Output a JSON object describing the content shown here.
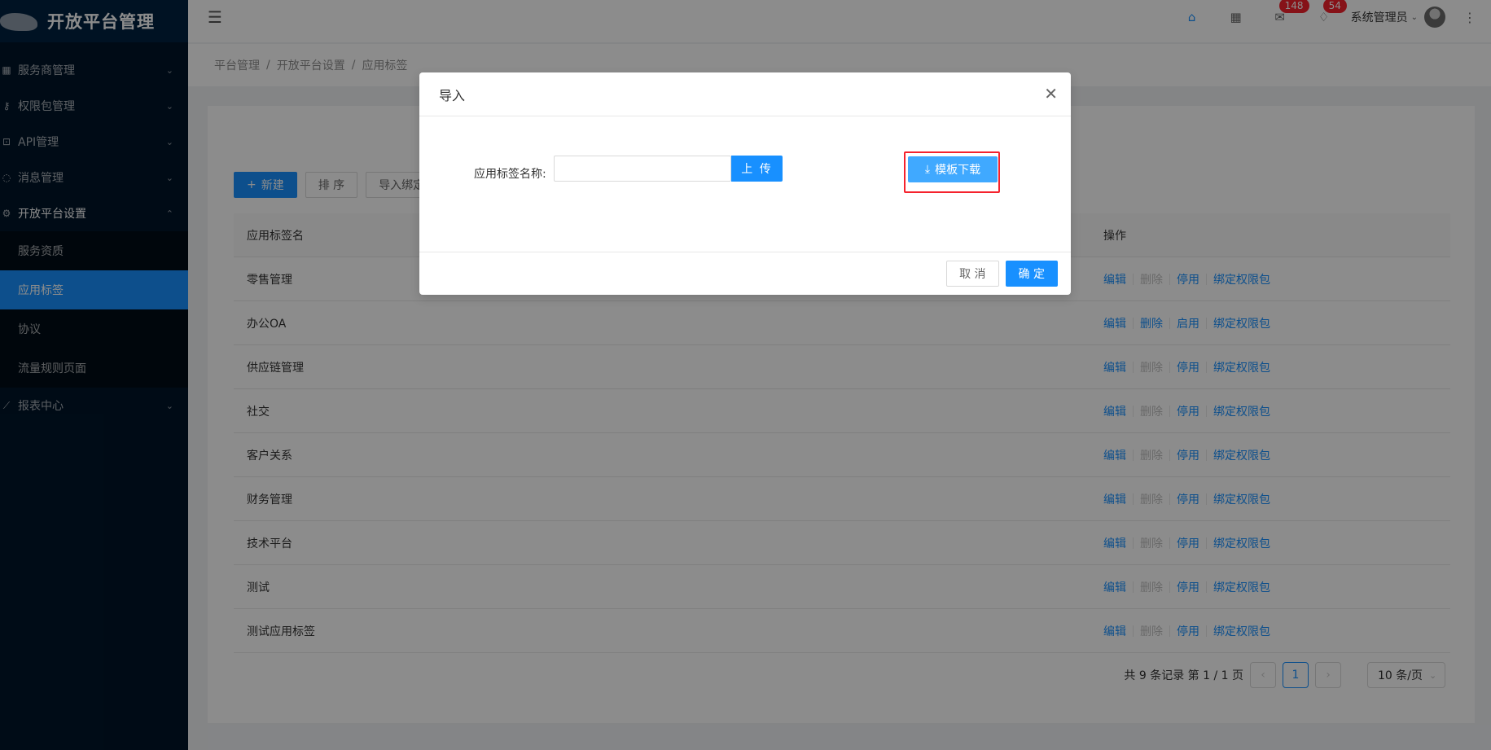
{
  "app": {
    "title": "开放平台管理"
  },
  "sidebar": {
    "items": [
      {
        "label": "服务商管理",
        "icon": "grid-icon"
      },
      {
        "label": "权限包管理",
        "icon": "key-icon"
      },
      {
        "label": "API管理",
        "icon": "api-icon"
      },
      {
        "label": "消息管理",
        "icon": "bell-icon"
      },
      {
        "label": "开放平台设置",
        "icon": "gear-icon"
      },
      {
        "label": "报表中心",
        "icon": "chart-icon"
      }
    ],
    "submenu": [
      {
        "label": "服务资质"
      },
      {
        "label": "应用标签"
      },
      {
        "label": "协议"
      },
      {
        "label": "流量规则页面"
      }
    ]
  },
  "header": {
    "mail_count": "148",
    "notice_count": "54",
    "user_name": "系统管理员"
  },
  "breadcrumb": [
    "平台管理",
    "开放平台设置",
    "应用标签"
  ],
  "toolbar": {
    "new_label": "新建",
    "sort_label": "排 序",
    "import_label": "导入绑定"
  },
  "table": {
    "headers": {
      "name": "应用标签名",
      "ops": "操作"
    },
    "op_labels": {
      "edit": "编辑",
      "delete": "删除",
      "bind": "绑定权限包"
    },
    "rows": [
      {
        "name": "零售管理",
        "toggle": "停用"
      },
      {
        "name": "办公OA",
        "toggle": "启用"
      },
      {
        "name": "供应链管理",
        "toggle": "停用"
      },
      {
        "name": "社交",
        "toggle": "停用"
      },
      {
        "name": "客户关系",
        "toggle": "停用"
      },
      {
        "name": "财务管理",
        "toggle": "停用"
      },
      {
        "name": "技术平台",
        "toggle": "停用"
      },
      {
        "name": "测试",
        "toggle": "停用"
      },
      {
        "name": "测试应用标签",
        "toggle": "停用"
      }
    ]
  },
  "pagination": {
    "summary": "共 9 条记录 第 1 / 1 页",
    "current": "1",
    "page_size": "10 条/页"
  },
  "modal": {
    "title": "导入",
    "field_label": "应用标签名称:",
    "upload_label": "上 传",
    "download_label": "模板下载",
    "cancel_label": "取 消",
    "ok_label": "确 定"
  }
}
